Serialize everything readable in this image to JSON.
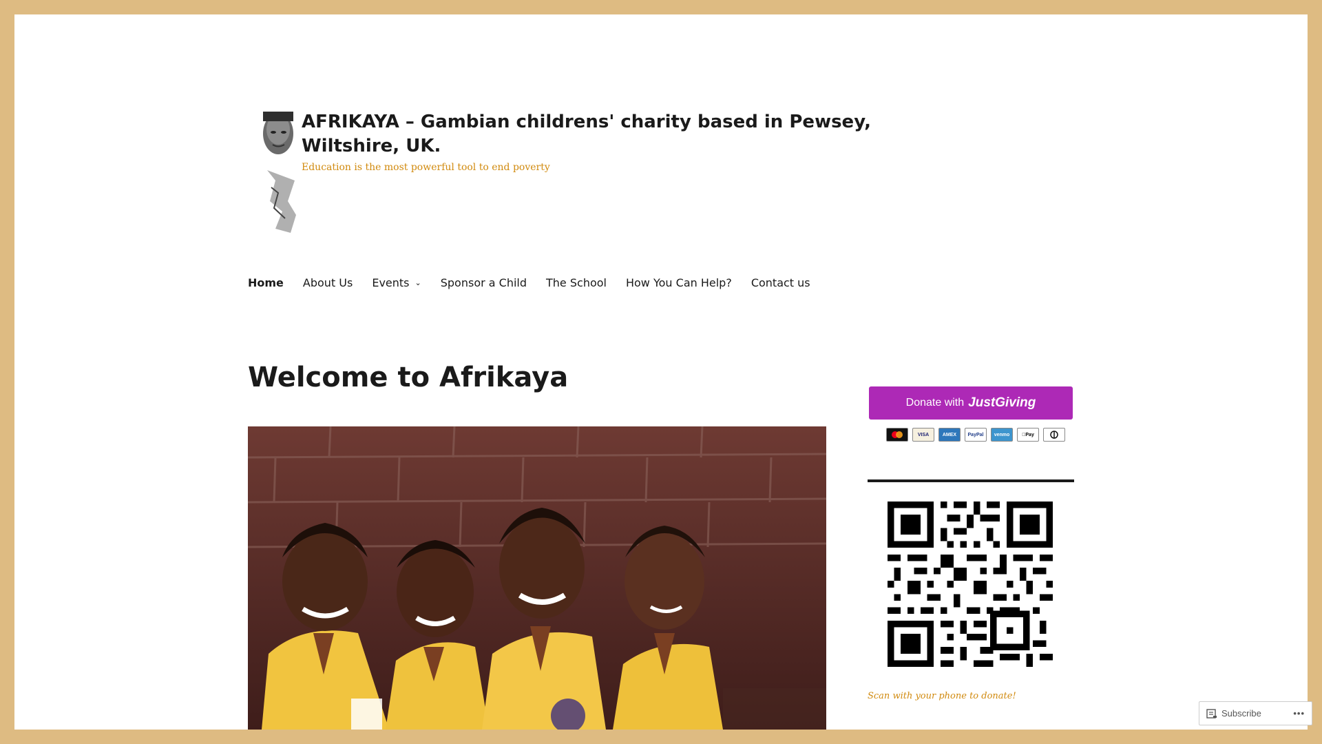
{
  "site": {
    "title": "AFRIKAYA – Gambian childrens' charity based in Pewsey, Wiltshire, UK.",
    "tagline": "Education is the most powerful tool to end poverty"
  },
  "nav": {
    "items": [
      {
        "label": "Home",
        "active": true
      },
      {
        "label": "About Us"
      },
      {
        "label": "Events",
        "has_submenu": true
      },
      {
        "label": "Sponsor a Child"
      },
      {
        "label": "The School"
      },
      {
        "label": "How You Can Help?"
      },
      {
        "label": "Contact us"
      }
    ]
  },
  "main": {
    "page_title": "Welcome to Afrikaya"
  },
  "sidebar": {
    "donate_prefix": "Donate with",
    "donate_brand": "JustGiving",
    "payment_methods": [
      "mastercard",
      "VISA",
      "AMEX",
      "PayPal",
      "venmo",
      "Apple Pay",
      "Diners"
    ],
    "qr_caption": "Scan with your phone to donate!"
  },
  "subscribe_bar": {
    "label": "Subscribe",
    "more": "•••"
  },
  "colors": {
    "border": "#debb82",
    "accent": "#d18a0e",
    "justgiving": "#ad29b6"
  }
}
